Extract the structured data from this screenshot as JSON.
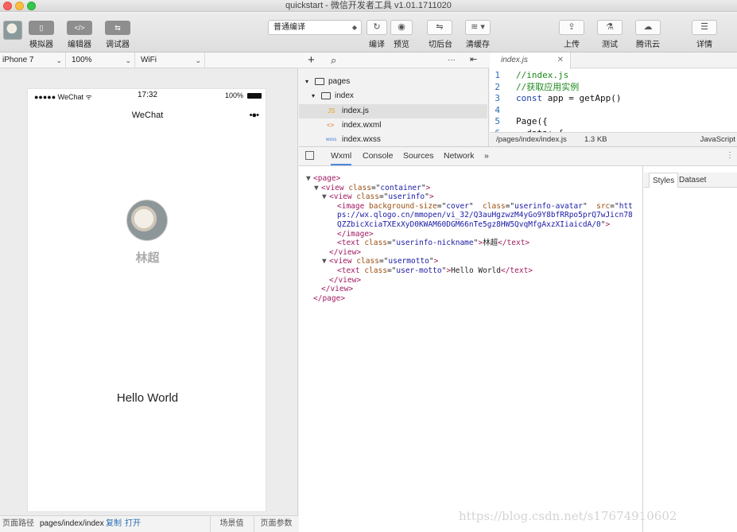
{
  "window": {
    "title": "quickstart - 微信开发者工具 v1.01.1711020"
  },
  "toolbar": {
    "left_buttons": [
      {
        "label": "模拟器",
        "icon": "phone-icon",
        "glyph": "▯"
      },
      {
        "label": "编辑器",
        "icon": "code-icon",
        "glyph": "</>"
      },
      {
        "label": "调试器",
        "icon": "debug-icon",
        "glyph": "⇆"
      }
    ],
    "compile_mode": "普通编译",
    "actions": [
      {
        "label": "编译",
        "icon": "refresh-icon",
        "glyph": "↻"
      },
      {
        "label": "预览",
        "icon": "eye-icon",
        "glyph": "◉"
      },
      {
        "label": "切后台",
        "icon": "background-icon",
        "glyph": "⇋"
      },
      {
        "label": "清缓存",
        "icon": "layers-icon",
        "glyph": "≋ ▾"
      }
    ],
    "right_actions": [
      {
        "label": "上传",
        "icon": "upload-icon",
        "glyph": "⇪"
      },
      {
        "label": "测试",
        "icon": "flask-icon",
        "glyph": "⚗"
      },
      {
        "label": "腾讯云",
        "icon": "cloud-icon",
        "glyph": "☁"
      },
      {
        "label": "详情",
        "icon": "menu-icon",
        "glyph": "☰"
      }
    ]
  },
  "simulator": {
    "device": "iPhone 7",
    "zoom": "100%",
    "network": "WiFi",
    "status_carrier": "●●●●● WeChat ᯤ",
    "status_time": "17:32",
    "status_battery": "100%",
    "nav_title": "WeChat",
    "nav_menu": "•●•",
    "nickname": "林超",
    "motto": "Hello World"
  },
  "footer": {
    "path_label": "页面路径",
    "path": "pages/index/index",
    "copy": "复制",
    "open": "打开",
    "scene": "场景值",
    "params": "页面参数"
  },
  "file_tree": {
    "add": "+",
    "search": "⌕",
    "more": "···",
    "collapse": "⇤",
    "items": [
      {
        "name": "pages",
        "type": "folder",
        "depth": 0,
        "glyph": "▾",
        "icon": "folder-icon"
      },
      {
        "name": "index",
        "type": "folder",
        "depth": 1,
        "glyph": "▾",
        "icon": "folder-icon"
      },
      {
        "name": "index.js",
        "type": "js",
        "depth": 2,
        "badge": "JS",
        "selected": true,
        "icon": "js-file-icon"
      },
      {
        "name": "index.wxml",
        "type": "wxml",
        "depth": 2,
        "badge": "<>",
        "icon": "wxml-file-icon"
      },
      {
        "name": "index.wxss",
        "type": "wxss",
        "depth": 2,
        "badge": "wxss",
        "icon": "wxss-file-icon"
      }
    ]
  },
  "editor": {
    "tab": "index.js",
    "close": "✕",
    "lines": [
      {
        "n": "1",
        "parts": [
          {
            "c": "cm",
            "t": "//index.js"
          }
        ]
      },
      {
        "n": "2",
        "parts": [
          {
            "c": "cm",
            "t": "//获取应用实例"
          }
        ]
      },
      {
        "n": "3",
        "parts": [
          {
            "c": "kw",
            "t": "const "
          },
          {
            "c": "tx",
            "t": "app = getApp()"
          }
        ]
      },
      {
        "n": "4",
        "parts": []
      },
      {
        "n": "5",
        "parts": [
          {
            "c": "tx",
            "t": "Page({"
          }
        ]
      },
      {
        "n": "6",
        "parts": [
          {
            "c": "tx",
            "t": "  data: {"
          }
        ]
      }
    ],
    "file_path": "/pages/index/index.js",
    "file_size": "1.3 KB",
    "language": "JavaScript"
  },
  "devtools": {
    "tabs": [
      "Wxml",
      "Console",
      "Sources",
      "Network",
      "»"
    ],
    "active_tab": "Wxml",
    "side_tabs": [
      "Styles",
      "Dataset"
    ],
    "dom": [
      {
        "d": 0,
        "arrow": "▼",
        "parts": [
          {
            "c": "tg",
            "t": "<page>"
          }
        ]
      },
      {
        "d": 1,
        "arrow": "▼",
        "parts": [
          {
            "c": "tg",
            "t": "<view "
          },
          {
            "c": "an",
            "t": "class"
          },
          {
            "c": "txt",
            "t": "=\""
          },
          {
            "c": "av",
            "t": "container"
          },
          {
            "c": "txt",
            "t": "\""
          },
          {
            "c": "tg",
            "t": ">"
          }
        ]
      },
      {
        "d": 2,
        "arrow": "▼",
        "parts": [
          {
            "c": "tg",
            "t": "<view "
          },
          {
            "c": "an",
            "t": "class"
          },
          {
            "c": "txt",
            "t": "=\""
          },
          {
            "c": "av",
            "t": "userinfo"
          },
          {
            "c": "txt",
            "t": "\""
          },
          {
            "c": "tg",
            "t": ">"
          }
        ]
      },
      {
        "d": 3,
        "arrow": "",
        "parts": [
          {
            "c": "tg",
            "t": "<image "
          },
          {
            "c": "an",
            "t": "background-size"
          },
          {
            "c": "txt",
            "t": "=\""
          },
          {
            "c": "av",
            "t": "cover"
          },
          {
            "c": "txt",
            "t": "\"  "
          },
          {
            "c": "an",
            "t": "class"
          },
          {
            "c": "txt",
            "t": "=\""
          },
          {
            "c": "av",
            "t": "userinfo-avatar"
          },
          {
            "c": "txt",
            "t": "\"  "
          },
          {
            "c": "an",
            "t": "src"
          },
          {
            "c": "txt",
            "t": "=\""
          },
          {
            "c": "av",
            "t": "htt"
          }
        ]
      },
      {
        "d": 3,
        "arrow": "",
        "parts": [
          {
            "c": "av",
            "t": "ps://wx.qlogo.cn/mmopen/vi_32/Q3auHgzwzM4yGo9Y8bfRRpo5prQ7wJicn78"
          }
        ]
      },
      {
        "d": 3,
        "arrow": "",
        "parts": [
          {
            "c": "av",
            "t": "QZZbicXciaTXExXyD0KWAM60DGM66nTe5gz8HW5QvqMfgAxzXIiaicdA/0"
          },
          {
            "c": "txt",
            "t": "\""
          },
          {
            "c": "tg",
            "t": ">"
          }
        ]
      },
      {
        "d": 3,
        "arrow": "",
        "parts": [
          {
            "c": "tg",
            "t": "</image>"
          }
        ]
      },
      {
        "d": 3,
        "arrow": "",
        "parts": [
          {
            "c": "tg",
            "t": "<text "
          },
          {
            "c": "an",
            "t": "class"
          },
          {
            "c": "txt",
            "t": "=\""
          },
          {
            "c": "av",
            "t": "userinfo-nickname"
          },
          {
            "c": "txt",
            "t": "\""
          },
          {
            "c": "tg",
            "t": ">"
          },
          {
            "c": "txt",
            "t": "林超"
          },
          {
            "c": "tg",
            "t": "</text>"
          }
        ]
      },
      {
        "d": 2,
        "arrow": "",
        "parts": [
          {
            "c": "tg",
            "t": "</view>"
          }
        ]
      },
      {
        "d": 2,
        "arrow": "▼",
        "parts": [
          {
            "c": "tg",
            "t": "<view "
          },
          {
            "c": "an",
            "t": "class"
          },
          {
            "c": "txt",
            "t": "=\""
          },
          {
            "c": "av",
            "t": "usermotto"
          },
          {
            "c": "txt",
            "t": "\""
          },
          {
            "c": "tg",
            "t": ">"
          }
        ]
      },
      {
        "d": 3,
        "arrow": "",
        "parts": [
          {
            "c": "tg",
            "t": "<text "
          },
          {
            "c": "an",
            "t": "class"
          },
          {
            "c": "txt",
            "t": "=\""
          },
          {
            "c": "av",
            "t": "user-motto"
          },
          {
            "c": "txt",
            "t": "\""
          },
          {
            "c": "tg",
            "t": ">"
          },
          {
            "c": "txt",
            "t": "Hello World"
          },
          {
            "c": "tg",
            "t": "</text>"
          }
        ]
      },
      {
        "d": 2,
        "arrow": "",
        "parts": [
          {
            "c": "tg",
            "t": "</view>"
          }
        ]
      },
      {
        "d": 1,
        "arrow": "",
        "parts": [
          {
            "c": "tg",
            "t": "</view>"
          }
        ]
      },
      {
        "d": 0,
        "arrow": "",
        "parts": [
          {
            "c": "tg",
            "t": "</page>"
          }
        ]
      }
    ]
  },
  "watermark": "https://blog.csdn.net/s17674910602",
  "colors": {
    "accent": "#4a89dc",
    "toolbar_button": "#8e8e8e",
    "code_comment": "#1d8a1d",
    "code_keyword": "#1b3fa8"
  }
}
